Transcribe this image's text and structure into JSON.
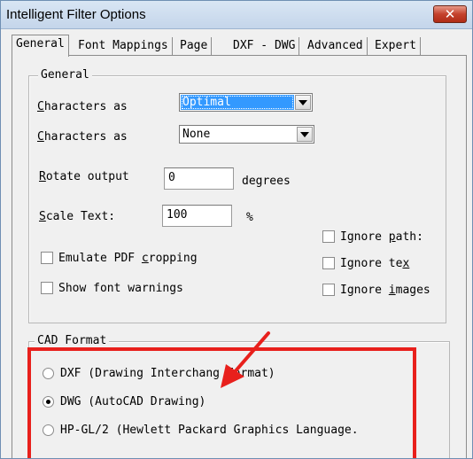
{
  "window": {
    "title": "Intelligent Filter Options",
    "close_label": "✕"
  },
  "tabs": [
    {
      "label": "General"
    },
    {
      "label": "Font Mappings"
    },
    {
      "label": "Page"
    },
    {
      "label": "DXF - DWG"
    },
    {
      "label": "Advanced"
    },
    {
      "label": "Expert"
    }
  ],
  "general": {
    "legend": "General",
    "characters_as_1": {
      "label": "Characters as",
      "value": "Optimal"
    },
    "characters_as_2": {
      "label": "Characters as",
      "value": "None"
    },
    "rotate": {
      "label": "Rotate output",
      "value": "0",
      "unit": "degrees"
    },
    "scale": {
      "label": "Scale Text:",
      "value": "100",
      "unit": "%"
    },
    "checks": {
      "emulate_pdf": {
        "label": "Emulate PDF cropping",
        "checked": false
      },
      "show_font": {
        "label": "Show font warnings",
        "checked": false
      },
      "ignore_paths": {
        "label": "Ignore path:",
        "checked": false
      },
      "ignore_text": {
        "label": "Ignore tex",
        "checked": false
      },
      "ignore_images": {
        "label": "Ignore images",
        "checked": false
      }
    }
  },
  "cad": {
    "legend": "CAD Format",
    "options": [
      {
        "label": "DXF (Drawing Interchang Format)",
        "selected": false
      },
      {
        "label": "DWG (AutoCAD Drawing)",
        "selected": true
      },
      {
        "label": "HP-GL/2 (Hewlett Packard Graphics Language.",
        "selected": false
      }
    ]
  },
  "colors": {
    "annotation_red": "#e8201c",
    "selection_blue": "#3399ff"
  }
}
